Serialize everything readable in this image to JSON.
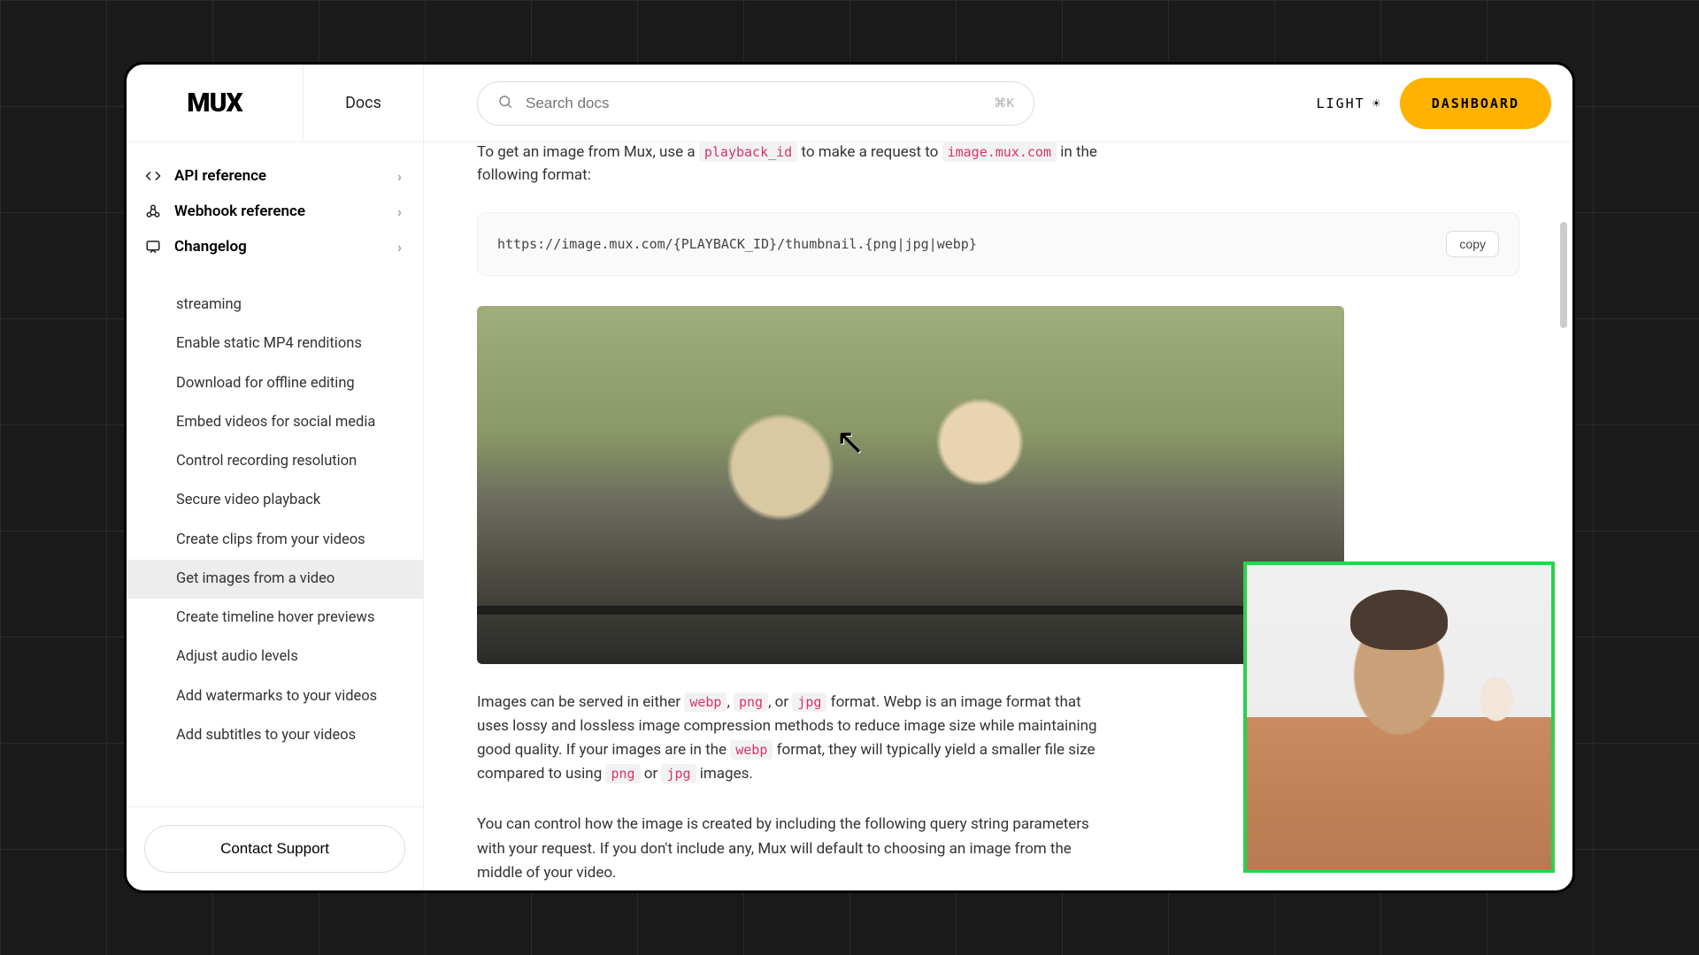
{
  "header": {
    "logo": "MUX",
    "docs": "Docs",
    "search_placeholder": "Search docs",
    "search_shortcut": "⌘K",
    "theme_label": "LIGHT",
    "dashboard": "DASHBOARD"
  },
  "sidebar": {
    "primary": [
      {
        "label": "API reference",
        "icon": "code"
      },
      {
        "label": "Webhook reference",
        "icon": "webhook"
      },
      {
        "label": "Changelog",
        "icon": "chat"
      }
    ],
    "items": [
      "streaming",
      "Enable static MP4 renditions",
      "Download for offline editing",
      "Embed videos for social media",
      "Control recording resolution",
      "Secure video playback",
      "Create clips from your videos",
      "Get images from a video",
      "Create timeline hover previews",
      "Adjust audio levels",
      "Add watermarks to your videos",
      "Add subtitles to your videos"
    ],
    "active_index": 7,
    "contact": "Contact Support"
  },
  "content": {
    "lead_pre": "To get an image from Mux, use a ",
    "lead_code1": "playback_id",
    "lead_mid": " to make a request to ",
    "lead_code2": "image.mux.com",
    "lead_post": " in the following format:",
    "code": "https://image.mux.com/{PLAYBACK_ID}/thumbnail.{png|jpg|webp}",
    "copy": "copy",
    "p2_a": "Images can be served in either ",
    "p2_c1": "webp",
    "p2_b": ", ",
    "p2_c2": "png",
    "p2_c": ", or ",
    "p2_c3": "jpg",
    "p2_d": " format. Webp is an image format that uses lossy and lossless image compression methods to reduce image size while maintaining good quality. If your images are in the ",
    "p2_c4": "webp",
    "p2_e": " format, they will typically yield a smaller file size compared to using ",
    "p2_c5": "png",
    "p2_f": " or ",
    "p2_c6": "jpg",
    "p2_g": " images.",
    "p3": "You can control how the image is created by including the following query string parameters with your request. If you don't include any, Mux will default to choosing an image from the middle of your video."
  }
}
